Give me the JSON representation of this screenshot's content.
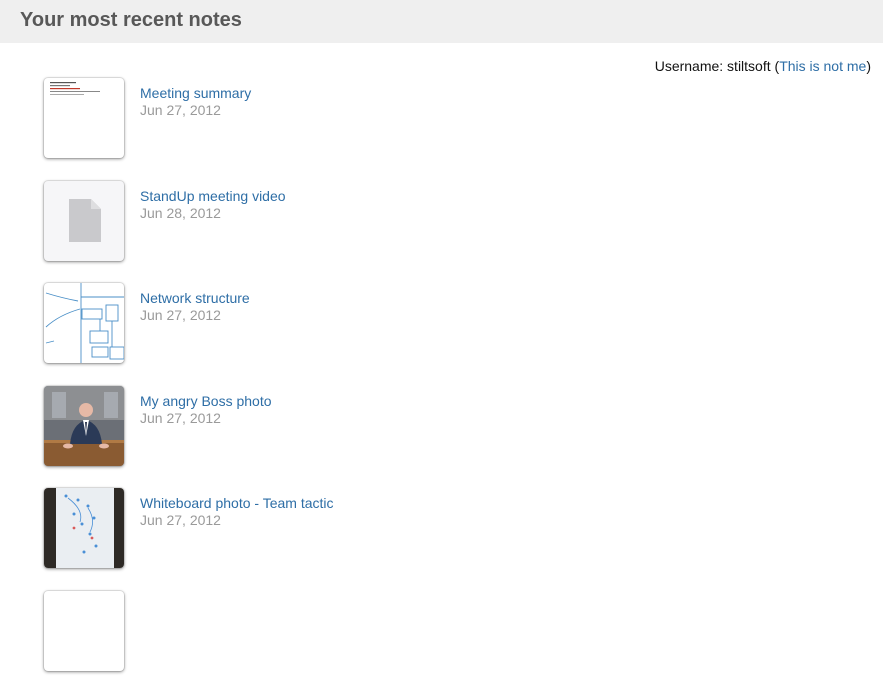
{
  "header": {
    "title": "Your most recent notes"
  },
  "user": {
    "prefix": "Username: stiltsoft (",
    "not_me_label": "This is not me",
    "suffix": ")"
  },
  "notes": [
    {
      "title": "Meeting summary",
      "date": "Jun 27, 2012",
      "thumb": "document-thumbnail"
    },
    {
      "title": "StandUp meeting video",
      "date": "Jun 28, 2012",
      "thumb": "file-icon"
    },
    {
      "title": "Network structure",
      "date": "Jun 27, 2012",
      "thumb": "sketch-thumbnail"
    },
    {
      "title": "My angry Boss photo",
      "date": "Jun 27, 2012",
      "thumb": "photo-thumbnail"
    },
    {
      "title": "Whiteboard photo - Team tactic",
      "date": "Jun 27, 2012",
      "thumb": "whiteboard-thumbnail"
    },
    {
      "title": "",
      "date": "",
      "thumb": "document-thumbnail"
    }
  ]
}
